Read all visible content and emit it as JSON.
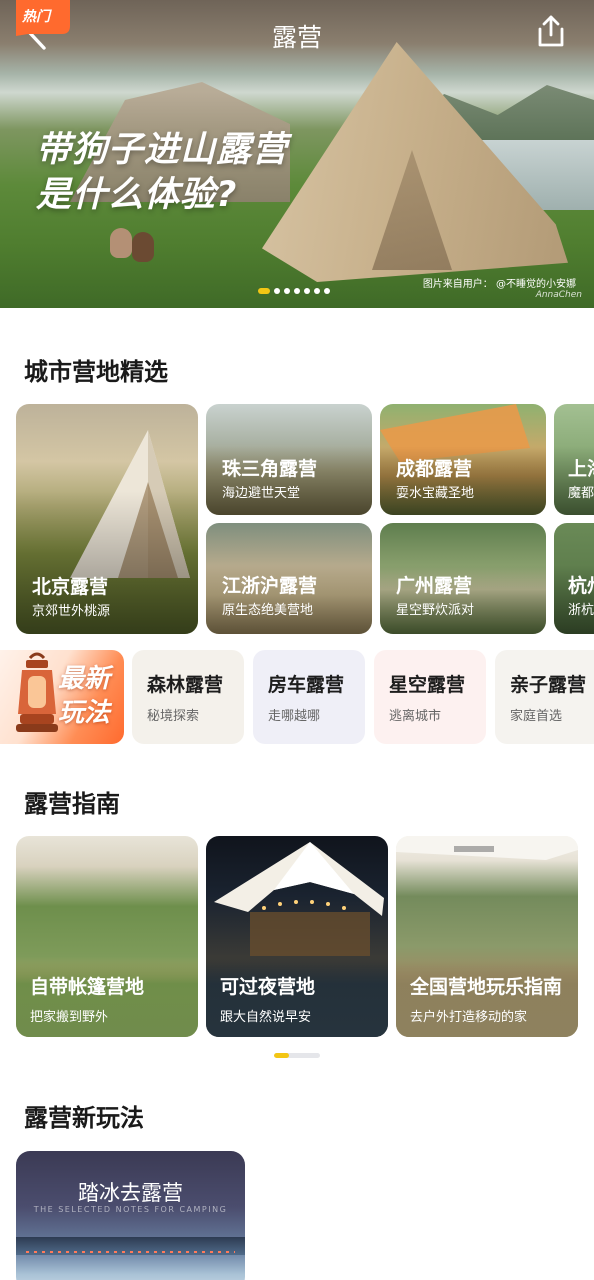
{
  "header": {
    "title": "露营",
    "back_icon": "back-icon",
    "share_icon": "share-icon"
  },
  "hero": {
    "headline_line1": "带狗子进山露营",
    "headline_line2": "是什么体验?",
    "credit": "图片来自用户： @不睡觉的小安娜",
    "watermark": "AnnaChen",
    "carousel_total": 7,
    "carousel_active": 1
  },
  "city_section": {
    "title": "城市营地精选",
    "hot_badge": "热门",
    "cities": [
      {
        "name": "北京露营",
        "sub": "京郊世外桃源"
      },
      {
        "name": "珠三角露营",
        "sub": "海边避世天堂"
      },
      {
        "name": "成都露营",
        "sub": "耍水宝藏圣地"
      },
      {
        "name": "上海露营",
        "sub": "魔都"
      },
      {
        "name": "江浙沪露营",
        "sub": "原生态绝美营地"
      },
      {
        "name": "广州露营",
        "sub": "星空野炊派对"
      },
      {
        "name": "杭州露营",
        "sub": "浙杭"
      }
    ]
  },
  "themes": {
    "new_play_label": "最新玩法",
    "items": [
      {
        "title": "森林露营",
        "sub": "秘境探索",
        "bg": "#f4f1eb"
      },
      {
        "title": "房车露营",
        "sub": "走哪越哪",
        "bg": "#efeff7"
      },
      {
        "title": "星空露营",
        "sub": "逃离城市",
        "bg": "#fdf1f0"
      },
      {
        "title": "亲子露营",
        "sub": "家庭首选",
        "bg": "#f5f3ef"
      }
    ]
  },
  "guide_section": {
    "title": "露营指南",
    "items": [
      {
        "name": "自带帐篷营地",
        "sub": "把家搬到野外"
      },
      {
        "name": "可过夜营地",
        "sub": "跟大自然说早安"
      },
      {
        "name": "全国营地玩乐指南",
        "sub": "去户外打造移动的家"
      }
    ],
    "progress": 0.33
  },
  "new_section": {
    "title": "露营新玩法",
    "card_title": "踏冰去露营",
    "card_sub": "THE SELECTED NOTES FOR CAMPING"
  },
  "colors": {
    "accent_yellow": "#f3c614",
    "hot_orange": "#ff6a2e"
  }
}
